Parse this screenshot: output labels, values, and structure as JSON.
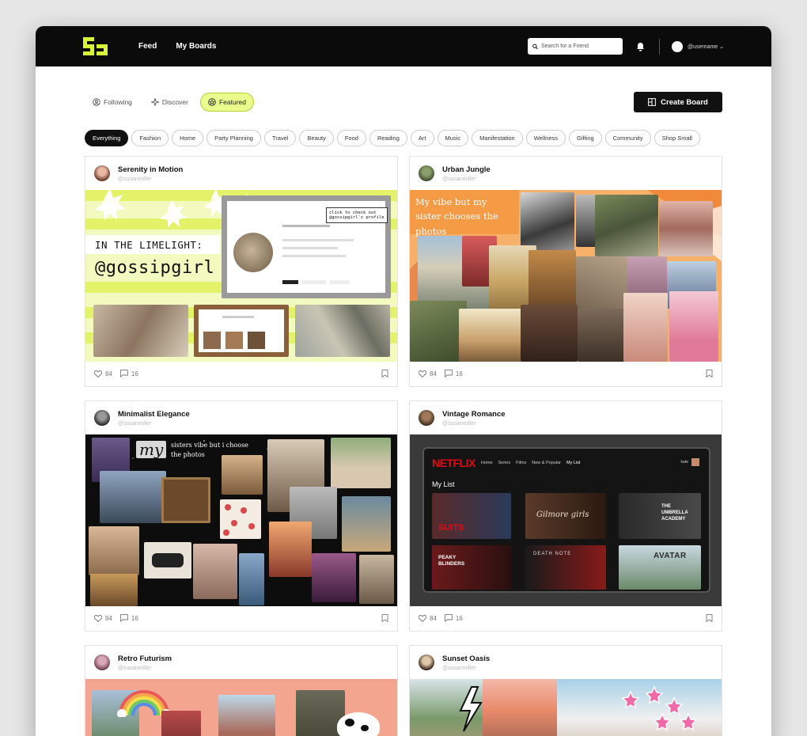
{
  "nav": {
    "links": [
      "Feed",
      "My Boards"
    ],
    "search_placeholder": "Search for a Friend",
    "username": "@username ⌄"
  },
  "tabs": [
    {
      "label": "Following",
      "icon": "person-icon"
    },
    {
      "label": "Discover",
      "icon": "sparkle-icon"
    },
    {
      "label": "Featured",
      "icon": "star-icon",
      "active": true
    }
  ],
  "create_button": "Create Board",
  "categories": [
    "Everything",
    "Fashion",
    "Home",
    "Party Planning",
    "Travel",
    "Beauty",
    "Food",
    "Reading",
    "Art",
    "Music",
    "Manifestation",
    "Wellness",
    "Gifting",
    "Community",
    "Shop Small"
  ],
  "boards": [
    {
      "title": "Serenity in Motion",
      "handle": "@susanmiller",
      "likes": "84",
      "comments": "16"
    },
    {
      "title": "Urban Jungle",
      "handle": "@susanmiller",
      "likes": "84",
      "comments": "16"
    },
    {
      "title": "Minimalist Elegance",
      "handle": "@susanmiller",
      "likes": "84",
      "comments": "16"
    },
    {
      "title": "Vintage Romance",
      "handle": "@susanmiller",
      "likes": "84",
      "comments": "16"
    },
    {
      "title": "Retro Futurism",
      "handle": "@susanmiller",
      "likes": "84",
      "comments": "16"
    },
    {
      "title": "Sunset Oasis",
      "handle": "@susanmiller",
      "likes": "84",
      "comments": "16"
    }
  ],
  "collage": {
    "limelight": "IN THE LIMELIGHT:",
    "gossipgirl": "@gossipgirl",
    "click_note": "click to check out @gossipgirl's profile",
    "vibe_caption": "My vibe but my sister chooses the photos",
    "my_word": "my",
    "sisters_caption": "sisters vibe but i choose the photos",
    "netflix_logo": "NETFLIX",
    "netflix_nav": [
      "Home",
      "Series",
      "Films",
      "New & Popular",
      "My List"
    ],
    "netflix_user": "kate",
    "my_list": "My List",
    "shows": [
      "SUITS",
      "Gilmore girls",
      "THE UMBRELLA ACADEMY",
      "PEAKY BLINDERS",
      "DEATH NOTE",
      "AVATAR"
    ]
  },
  "colors": {
    "accent": "#eafc8c",
    "topbar": "#0b0b0b",
    "netflix_red": "#e50914",
    "salmon": "#f4a58f"
  }
}
